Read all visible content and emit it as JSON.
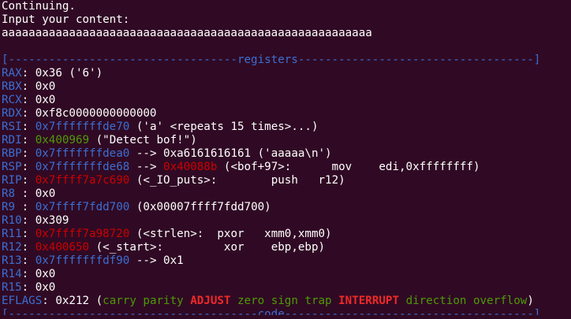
{
  "console": {
    "continuing": "Continuing.",
    "prompt": "Input your content:",
    "input_echo": "aaaaaaaaaaaaaaaaaaaaaaaaaaaaaaaaaaaaaaaaaaaaaaaaaaaaaaa"
  },
  "registers": {
    "header_left": "[----------------------------------",
    "header_title": "registers",
    "header_right": "-----------------------------------]",
    "RAX": {
      "name": "RAX",
      "value": "0x36 ('6')"
    },
    "RBX": {
      "name": "RBX",
      "value": "0x0"
    },
    "RCX": {
      "name": "RCX",
      "value": "0x0"
    },
    "RDX": {
      "name": "RDX",
      "value": "0xf8c0000000000000"
    },
    "RSI": {
      "name": "RSI",
      "addr": "0x7fffffffde70",
      "rest": "('a' <repeats 15 times>...)"
    },
    "RDI": {
      "name": "RDI",
      "addr": "0x400969",
      "rest": "(\"Detect bof!\")"
    },
    "RBP": {
      "name": "RBP",
      "addr": "0x7fffffffdea0",
      "rest": "--> 0xa6161616161 ('aaaaa\\n')"
    },
    "RSP": {
      "name": "RSP",
      "addr": "0x7fffffffde68",
      "arrow": "-->",
      "target": "0x40088b",
      "rest": "(<bof+97>:      mov    edi,0xffffffff)"
    },
    "RIP": {
      "name": "RIP",
      "addr": "0x7ffff7a7c690",
      "rest": "(<_IO_puts>:        push   r12)"
    },
    "R8": {
      "name": "R8 ",
      "value": "0x0"
    },
    "R9": {
      "name": "R9 ",
      "addr": "0x7ffff7fdd700",
      "rest": "(0x00007ffff7fdd700)"
    },
    "R10": {
      "name": "R10",
      "value": "0x309"
    },
    "R11": {
      "name": "R11",
      "addr": "0x7ffff7a98720",
      "rest": "(<strlen>:  pxor   xmm0,xmm0)"
    },
    "R12": {
      "name": "R12",
      "addr": "0x400650",
      "rest": "(<_start>:         xor    ebp,ebp)"
    },
    "R13": {
      "name": "R13",
      "addr": "0x7fffffffdf90",
      "rest": "--> 0x1"
    },
    "R14": {
      "name": "R14",
      "value": "0x0"
    },
    "R15": {
      "name": "R15",
      "value": "0x0"
    },
    "EFLAGS": {
      "name": "EFLAGS",
      "value": "0x212",
      "open": "(",
      "f1": "carry parity",
      "f2": "ADJUST",
      "f3": "zero sign trap",
      "f4": "INTERRUPT",
      "f5": "direction overflow",
      "close": ")"
    }
  },
  "code_header": {
    "left": "[-------------------------------------",
    "title": "code",
    "right": "-------------------------------------]"
  },
  "colors": {
    "background": "#300a24",
    "register_name": "#3b6fd4",
    "stack_addr": "#3b6fd4",
    "data_addr": "#4e9a06",
    "code_addr": "#cc0000",
    "flag_set": "#ef2929"
  }
}
